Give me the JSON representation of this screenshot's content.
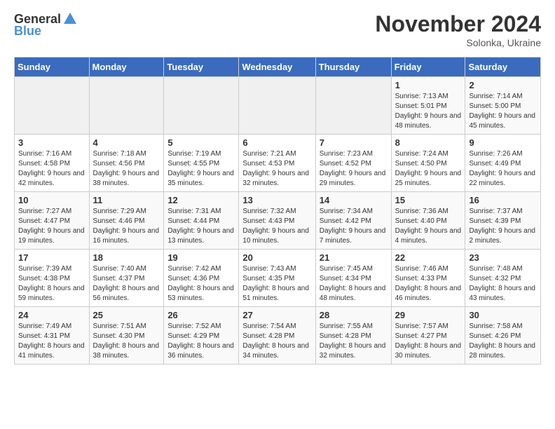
{
  "header": {
    "logo_general": "General",
    "logo_blue": "Blue",
    "month_title": "November 2024",
    "subtitle": "Solonka, Ukraine"
  },
  "days_of_week": [
    "Sunday",
    "Monday",
    "Tuesday",
    "Wednesday",
    "Thursday",
    "Friday",
    "Saturday"
  ],
  "weeks": [
    [
      {
        "day": "",
        "empty": true
      },
      {
        "day": "",
        "empty": true
      },
      {
        "day": "",
        "empty": true
      },
      {
        "day": "",
        "empty": true
      },
      {
        "day": "",
        "empty": true
      },
      {
        "day": "1",
        "sunrise": "Sunrise: 7:13 AM",
        "sunset": "Sunset: 5:01 PM",
        "daylight": "Daylight: 9 hours and 48 minutes."
      },
      {
        "day": "2",
        "sunrise": "Sunrise: 7:14 AM",
        "sunset": "Sunset: 5:00 PM",
        "daylight": "Daylight: 9 hours and 45 minutes."
      }
    ],
    [
      {
        "day": "3",
        "sunrise": "Sunrise: 7:16 AM",
        "sunset": "Sunset: 4:58 PM",
        "daylight": "Daylight: 9 hours and 42 minutes."
      },
      {
        "day": "4",
        "sunrise": "Sunrise: 7:18 AM",
        "sunset": "Sunset: 4:56 PM",
        "daylight": "Daylight: 9 hours and 38 minutes."
      },
      {
        "day": "5",
        "sunrise": "Sunrise: 7:19 AM",
        "sunset": "Sunset: 4:55 PM",
        "daylight": "Daylight: 9 hours and 35 minutes."
      },
      {
        "day": "6",
        "sunrise": "Sunrise: 7:21 AM",
        "sunset": "Sunset: 4:53 PM",
        "daylight": "Daylight: 9 hours and 32 minutes."
      },
      {
        "day": "7",
        "sunrise": "Sunrise: 7:23 AM",
        "sunset": "Sunset: 4:52 PM",
        "daylight": "Daylight: 9 hours and 29 minutes."
      },
      {
        "day": "8",
        "sunrise": "Sunrise: 7:24 AM",
        "sunset": "Sunset: 4:50 PM",
        "daylight": "Daylight: 9 hours and 25 minutes."
      },
      {
        "day": "9",
        "sunrise": "Sunrise: 7:26 AM",
        "sunset": "Sunset: 4:49 PM",
        "daylight": "Daylight: 9 hours and 22 minutes."
      }
    ],
    [
      {
        "day": "10",
        "sunrise": "Sunrise: 7:27 AM",
        "sunset": "Sunset: 4:47 PM",
        "daylight": "Daylight: 9 hours and 19 minutes."
      },
      {
        "day": "11",
        "sunrise": "Sunrise: 7:29 AM",
        "sunset": "Sunset: 4:46 PM",
        "daylight": "Daylight: 9 hours and 16 minutes."
      },
      {
        "day": "12",
        "sunrise": "Sunrise: 7:31 AM",
        "sunset": "Sunset: 4:44 PM",
        "daylight": "Daylight: 9 hours and 13 minutes."
      },
      {
        "day": "13",
        "sunrise": "Sunrise: 7:32 AM",
        "sunset": "Sunset: 4:43 PM",
        "daylight": "Daylight: 9 hours and 10 minutes."
      },
      {
        "day": "14",
        "sunrise": "Sunrise: 7:34 AM",
        "sunset": "Sunset: 4:42 PM",
        "daylight": "Daylight: 9 hours and 7 minutes."
      },
      {
        "day": "15",
        "sunrise": "Sunrise: 7:36 AM",
        "sunset": "Sunset: 4:40 PM",
        "daylight": "Daylight: 9 hours and 4 minutes."
      },
      {
        "day": "16",
        "sunrise": "Sunrise: 7:37 AM",
        "sunset": "Sunset: 4:39 PM",
        "daylight": "Daylight: 9 hours and 2 minutes."
      }
    ],
    [
      {
        "day": "17",
        "sunrise": "Sunrise: 7:39 AM",
        "sunset": "Sunset: 4:38 PM",
        "daylight": "Daylight: 8 hours and 59 minutes."
      },
      {
        "day": "18",
        "sunrise": "Sunrise: 7:40 AM",
        "sunset": "Sunset: 4:37 PM",
        "daylight": "Daylight: 8 hours and 56 minutes."
      },
      {
        "day": "19",
        "sunrise": "Sunrise: 7:42 AM",
        "sunset": "Sunset: 4:36 PM",
        "daylight": "Daylight: 8 hours and 53 minutes."
      },
      {
        "day": "20",
        "sunrise": "Sunrise: 7:43 AM",
        "sunset": "Sunset: 4:35 PM",
        "daylight": "Daylight: 8 hours and 51 minutes."
      },
      {
        "day": "21",
        "sunrise": "Sunrise: 7:45 AM",
        "sunset": "Sunset: 4:34 PM",
        "daylight": "Daylight: 8 hours and 48 minutes."
      },
      {
        "day": "22",
        "sunrise": "Sunrise: 7:46 AM",
        "sunset": "Sunset: 4:33 PM",
        "daylight": "Daylight: 8 hours and 46 minutes."
      },
      {
        "day": "23",
        "sunrise": "Sunrise: 7:48 AM",
        "sunset": "Sunset: 4:32 PM",
        "daylight": "Daylight: 8 hours and 43 minutes."
      }
    ],
    [
      {
        "day": "24",
        "sunrise": "Sunrise: 7:49 AM",
        "sunset": "Sunset: 4:31 PM",
        "daylight": "Daylight: 8 hours and 41 minutes."
      },
      {
        "day": "25",
        "sunrise": "Sunrise: 7:51 AM",
        "sunset": "Sunset: 4:30 PM",
        "daylight": "Daylight: 8 hours and 38 minutes."
      },
      {
        "day": "26",
        "sunrise": "Sunrise: 7:52 AM",
        "sunset": "Sunset: 4:29 PM",
        "daylight": "Daylight: 8 hours and 36 minutes."
      },
      {
        "day": "27",
        "sunrise": "Sunrise: 7:54 AM",
        "sunset": "Sunset: 4:28 PM",
        "daylight": "Daylight: 8 hours and 34 minutes."
      },
      {
        "day": "28",
        "sunrise": "Sunrise: 7:55 AM",
        "sunset": "Sunset: 4:28 PM",
        "daylight": "Daylight: 8 hours and 32 minutes."
      },
      {
        "day": "29",
        "sunrise": "Sunrise: 7:57 AM",
        "sunset": "Sunset: 4:27 PM",
        "daylight": "Daylight: 8 hours and 30 minutes."
      },
      {
        "day": "30",
        "sunrise": "Sunrise: 7:58 AM",
        "sunset": "Sunset: 4:26 PM",
        "daylight": "Daylight: 8 hours and 28 minutes."
      }
    ]
  ]
}
